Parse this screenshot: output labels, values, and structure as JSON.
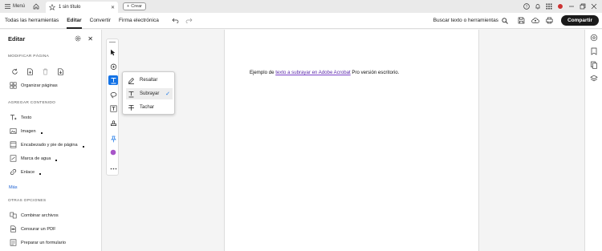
{
  "titlebar": {
    "menu_label": "Menú",
    "tab_title": "1 sin título",
    "create_label": "Crear"
  },
  "toolbar": {
    "tabs": [
      "Todas las herramientas",
      "Editar",
      "Convertir",
      "Firma electrónica"
    ],
    "search_label": "Buscar texto o herramientas",
    "share_label": "Compartir"
  },
  "sidebar": {
    "title": "Editar",
    "section_modify": "MODIFICAR PÁGINA",
    "organize_label": "Organizar páginas",
    "section_add": "AGREGAR CONTENIDO",
    "add_items": [
      "Texto",
      "Imagen",
      "Encabezado y pie de página",
      "Marca de agua",
      "Enlace"
    ],
    "more_label": "Más",
    "section_other": "OTRAS OPCIONES",
    "other_items": [
      "Combinar archivos",
      "Censurar un PDF",
      "Preparar un formulario"
    ]
  },
  "text_popup": {
    "items": [
      "Resaltar",
      "Subrayar",
      "Tachar"
    ],
    "selected": "Subrayar"
  },
  "document": {
    "text_before": "Ejemplo de ",
    "text_underlined": "texto a subrayar en Adobe Acrobat",
    "text_after": " Pro versión escritorio."
  },
  "colors": {
    "accent": "#1473e6",
    "underline": "#7a3fc8",
    "color_tool": "#a855c8",
    "share_bg": "#1a1a1a"
  }
}
